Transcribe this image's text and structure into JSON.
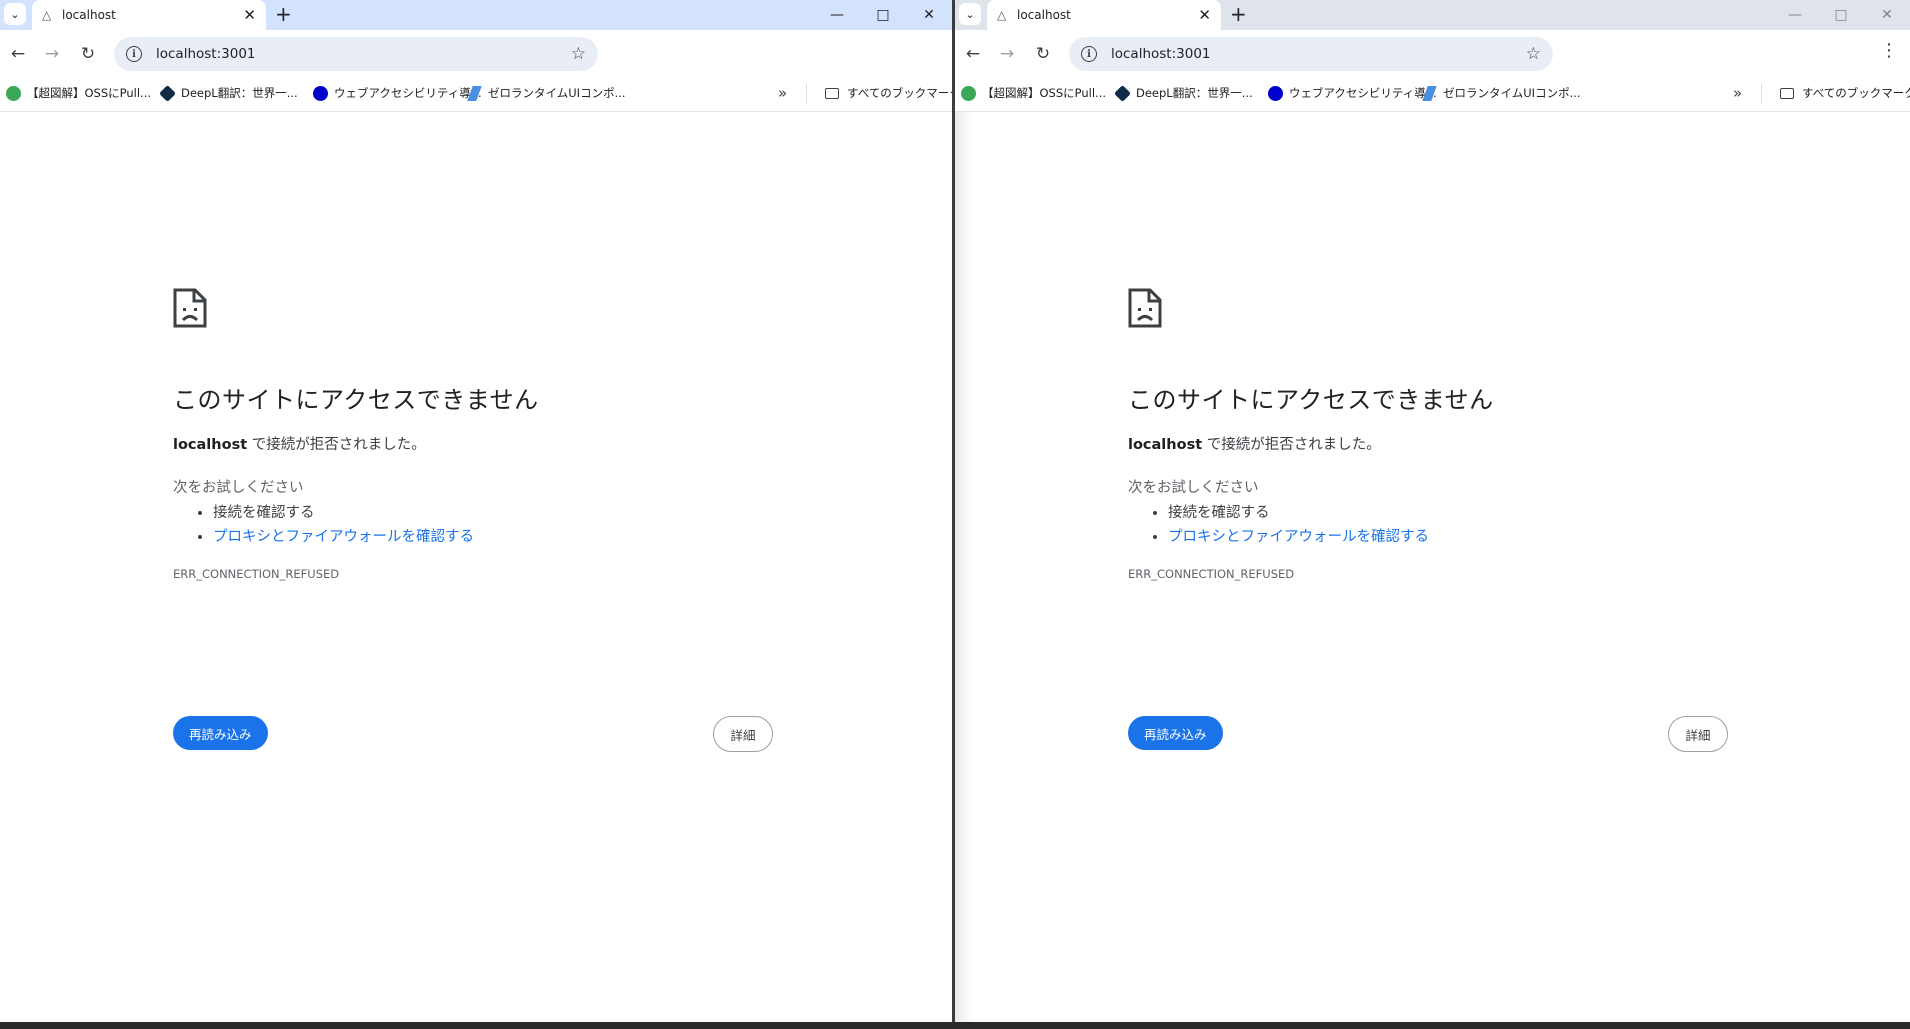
{
  "tab": {
    "title": "localhost"
  },
  "toolbar": {
    "url": "localhost:3001"
  },
  "bookmarks": [
    {
      "label": "【超図解】OSSにPull...",
      "icon_color": "#3aa757"
    },
    {
      "label": "DeepL翻訳：世界一...",
      "icon_color": "#0f2b46"
    },
    {
      "label": "ウェブアクセシビリティ導...",
      "icon_color": "#0000cc"
    },
    {
      "label": "ゼロランタイムUIコンポ...",
      "icon_color": "#4a90e2"
    }
  ],
  "all_bookmarks": "すべてのブックマーク",
  "error": {
    "title": "このサイトにアクセスできません",
    "host": "localhost",
    "desc_suffix": " で接続が拒否されました。",
    "try_label": "次をお試しください",
    "suggestions": [
      "接続を確認する",
      "プロキシとファイアウォールを確認する"
    ],
    "code": "ERR_CONNECTION_REFUSED",
    "reload": "再読み込み",
    "details": "詳細"
  },
  "colors": {
    "accent": "#1a73e8",
    "tabstrip_active": "#d3e3fd",
    "tabstrip_inactive": "#dfe3eb"
  }
}
